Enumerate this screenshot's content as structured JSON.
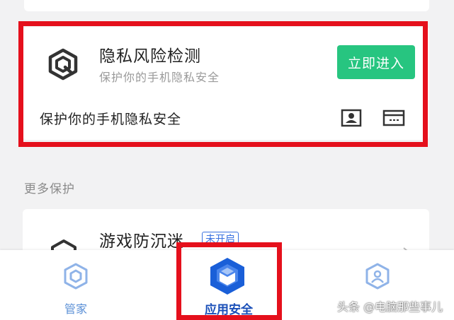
{
  "privacy_card": {
    "title": "隐私风险检测",
    "subtitle": "保护你的手机隐私安全",
    "enter_button": "立即进入",
    "feature_text": "保护你的手机隐私安全"
  },
  "more_section": {
    "label": "更多保护",
    "items": [
      {
        "title": "游戏防沉迷",
        "badge": "未开启"
      }
    ]
  },
  "tabbar": {
    "tabs": [
      {
        "label": "管家"
      },
      {
        "label": "应用安全"
      },
      {
        "label": ""
      }
    ]
  },
  "watermark": "头条 @电脑那些事儿",
  "colors": {
    "accent_green": "#27c580",
    "highlight_red": "#e5101c",
    "tab_active": "#1a5fd8",
    "tab_inactive": "#8fb3e8"
  }
}
